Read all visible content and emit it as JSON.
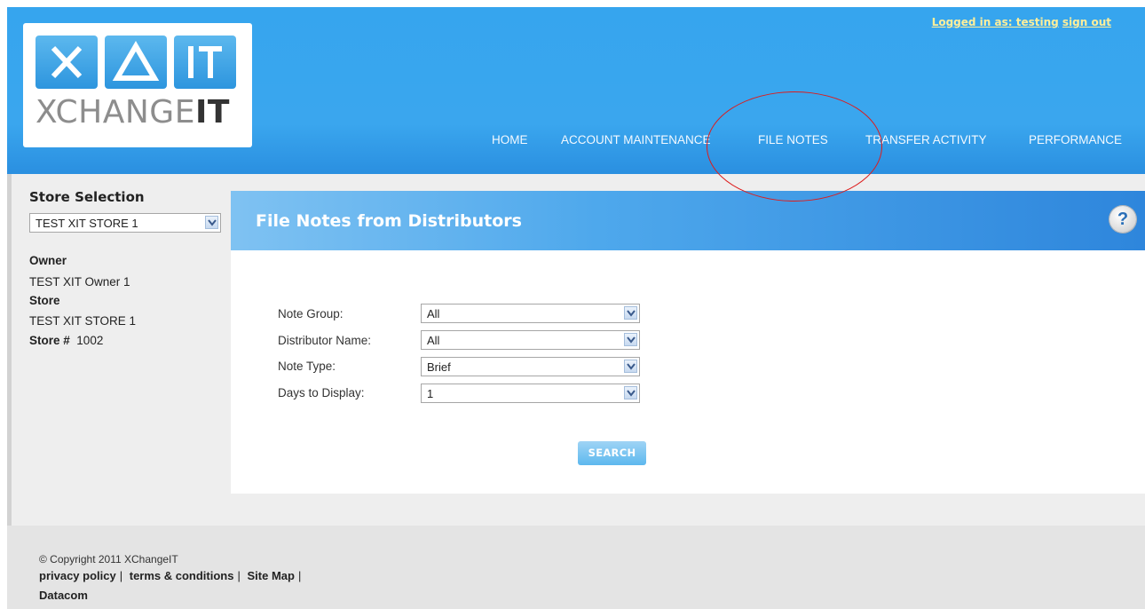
{
  "header": {
    "logo_letters": [
      "X",
      "Δ",
      "IT"
    ],
    "logo_text_light": "XCHANGE",
    "logo_text_bold": "IT",
    "login_prefix": "Logged in as: testing",
    "sign_out": "sign out",
    "nav": [
      {
        "label": "HOME"
      },
      {
        "label": "ACCOUNT MAINTENANCE"
      },
      {
        "label": "FILE NOTES"
      },
      {
        "label": "TRANSFER ACTIVITY"
      },
      {
        "label": "PERFORMANCE"
      }
    ]
  },
  "sidebar": {
    "title": "Store Selection",
    "store_select": "TEST XIT STORE 1",
    "owner_label": "Owner",
    "owner_value": "TEST XIT Owner 1",
    "store_label": "Store",
    "store_value": "TEST XIT STORE 1",
    "store_num_label": "Store #",
    "store_num_value": "1002"
  },
  "main": {
    "title": "File Notes from Distributors",
    "help_label": "?",
    "fields": [
      {
        "label": "Note Group:",
        "value": "All"
      },
      {
        "label": "Distributor Name:",
        "value": "All"
      },
      {
        "label": "Note Type:",
        "value": "Brief"
      },
      {
        "label": "Days to Display:",
        "value": "1"
      }
    ],
    "search_label": "SEARCH"
  },
  "footer": {
    "copyright": "© Copyright 2011 XChangeIT",
    "links": [
      "privacy policy",
      "terms & conditions",
      "Site Map"
    ],
    "datacom": "Datacom"
  },
  "colors": {
    "header_blue": "#3aa6ee",
    "annotation_red": "#dd1c1c"
  }
}
